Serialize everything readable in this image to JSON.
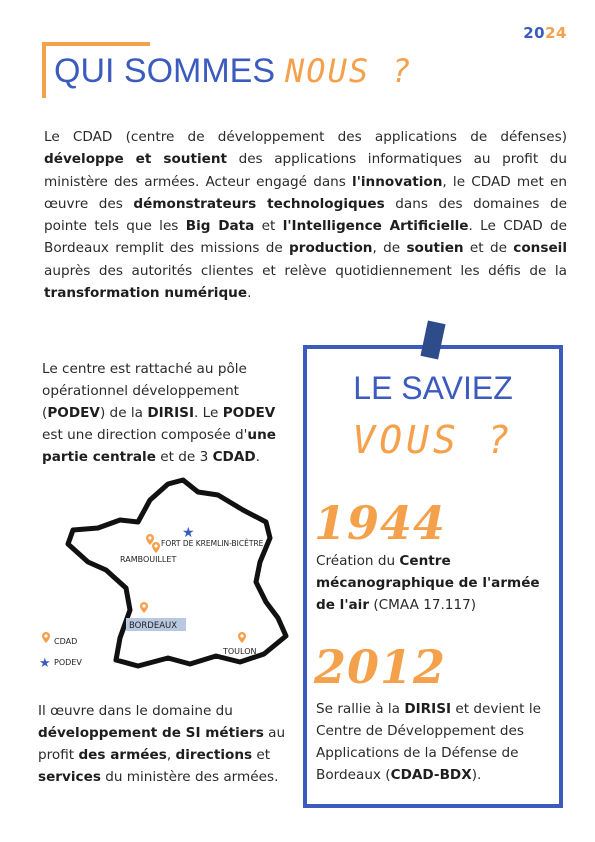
{
  "header": {
    "year_part1": "20",
    "year_part2": "24",
    "title_main": "QUI SOMMES",
    "title_hand": "NOUS ?"
  },
  "intro": [
    {
      "t": "Le CDAD (centre de développement des applications de défenses) ",
      "b": false
    },
    {
      "t": "développe et soutient",
      "b": true
    },
    {
      "t": " des applications informatiques au profit du ministère des armées. Acteur engagé dans ",
      "b": false
    },
    {
      "t": "l'innovation",
      "b": true
    },
    {
      "t": ", le CDAD met en œuvre des ",
      "b": false
    },
    {
      "t": "démonstrateurs technologiques",
      "b": true
    },
    {
      "t": " dans des domaines de pointe tels que les ",
      "b": false
    },
    {
      "t": "Big Data",
      "b": true
    },
    {
      "t": " et ",
      "b": false
    },
    {
      "t": "l'Intelligence Artificielle",
      "b": true
    },
    {
      "t": ". Le CDAD de Bordeaux remplit des missions de ",
      "b": false
    },
    {
      "t": "production",
      "b": true
    },
    {
      "t": ", de ",
      "b": false
    },
    {
      "t": "soutien",
      "b": true
    },
    {
      "t": " et de ",
      "b": false
    },
    {
      "t": "conseil",
      "b": true
    },
    {
      "t": " auprès des autorités clientes et relève quotidiennement les défis de la ",
      "b": false
    },
    {
      "t": "transformation numérique",
      "b": true
    },
    {
      "t": ".",
      "b": false
    }
  ],
  "left_text": [
    {
      "t": "Le centre est rattaché au pôle opérationnel développement (",
      "b": false
    },
    {
      "t": "PODEV",
      "b": true
    },
    {
      "t": ") de la ",
      "b": false
    },
    {
      "t": "DIRISI",
      "b": true
    },
    {
      "t": ". Le ",
      "b": false
    },
    {
      "t": "PODEV",
      "b": true
    },
    {
      "t": " est une direction composée d'",
      "b": false
    },
    {
      "t": "une partie centrale",
      "b": true
    },
    {
      "t": " et de 3 ",
      "b": false
    },
    {
      "t": "CDAD",
      "b": true
    },
    {
      "t": ".",
      "b": false
    }
  ],
  "map": {
    "labels": {
      "kremlin": "FORT DE KREMLIN-BICÊTRE",
      "rambouillet": "RAMBOUILLET",
      "bordeaux": "BORDEAUX",
      "toulon": "TOULON"
    },
    "legend": {
      "cdad": "CDAD",
      "podev": "PODEV"
    },
    "colors": {
      "pin": "#f5a04b",
      "star": "#3b5bbf",
      "highlight": "#b8c8e0"
    }
  },
  "bottom_text": [
    {
      "t": "Il œuvre dans le domaine du ",
      "b": false
    },
    {
      "t": "développement de SI métiers",
      "b": true
    },
    {
      "t": " au profit ",
      "b": false
    },
    {
      "t": "des armées",
      "b": true
    },
    {
      "t": ", ",
      "b": false
    },
    {
      "t": "directions",
      "b": true
    },
    {
      "t": " et ",
      "b": false
    },
    {
      "t": "services",
      "b": true
    },
    {
      "t": " du ministère des armées.",
      "b": false
    }
  ],
  "box": {
    "title": "LE SAVIEZ",
    "hand": "VOUS ?",
    "facts": [
      {
        "year": "1944",
        "text": [
          {
            "t": "Création du ",
            "b": false
          },
          {
            "t": "Centre mécanographique de l'armée de l'air",
            "b": true
          },
          {
            "t": " (CMAA 17.117)",
            "b": false
          }
        ]
      },
      {
        "year": "2012",
        "text": [
          {
            "t": "Se rallie à la ",
            "b": false
          },
          {
            "t": "DIRISI",
            "b": true
          },
          {
            "t": " et devient le Centre de Développement des Applications de la Défense de Bordeaux (",
            "b": false
          },
          {
            "t": "CDAD-BDX",
            "b": true
          },
          {
            "t": ").",
            "b": false
          }
        ]
      }
    ]
  },
  "colors": {
    "blue": "#3b5bbf",
    "orange": "#f5a04b"
  }
}
